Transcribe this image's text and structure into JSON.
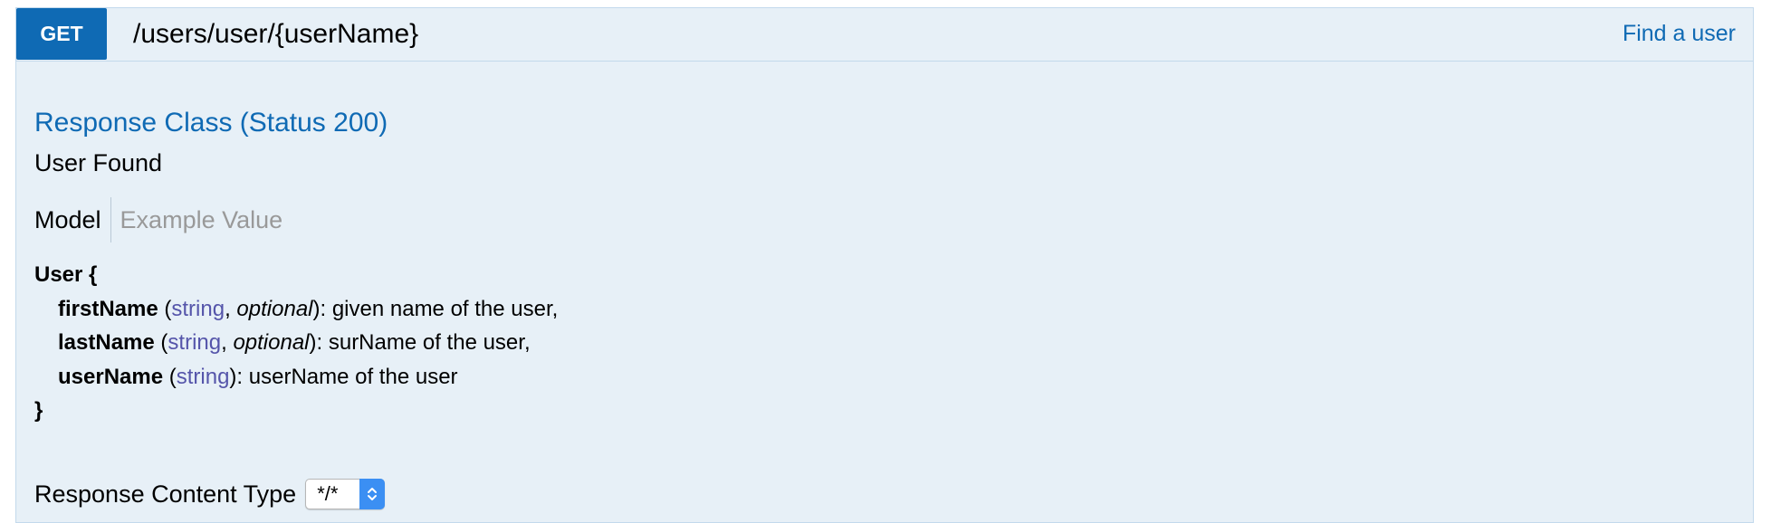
{
  "operation": {
    "method": "GET",
    "path": "/users/user/{userName}",
    "summary": "Find a user"
  },
  "response": {
    "title": "Response Class (Status 200)",
    "description": "User Found"
  },
  "tabs": {
    "model_label": "Model",
    "example_label": "Example Value"
  },
  "model": {
    "name": "User",
    "open_brace": "{",
    "close_brace": "}",
    "properties": [
      {
        "name": "firstName",
        "type": "string",
        "optional_label": "optional",
        "description": "given name of the user,"
      },
      {
        "name": "lastName",
        "type": "string",
        "optional_label": "optional",
        "description": "surName of the user,"
      },
      {
        "name": "userName",
        "type": "string",
        "description": "userName of the user"
      }
    ]
  },
  "content_type": {
    "label": "Response Content Type",
    "selected": "*/*"
  },
  "colors": {
    "method_get": "#0f6ab4",
    "panel_background": "#e7f0f7",
    "panel_border": "#c3d9ec",
    "link": "#0f6ab4",
    "type": "#5555aa",
    "select_arrow": "#3b8ff3"
  },
  "icons": {
    "select_arrow": "chevron-up-down-icon"
  }
}
